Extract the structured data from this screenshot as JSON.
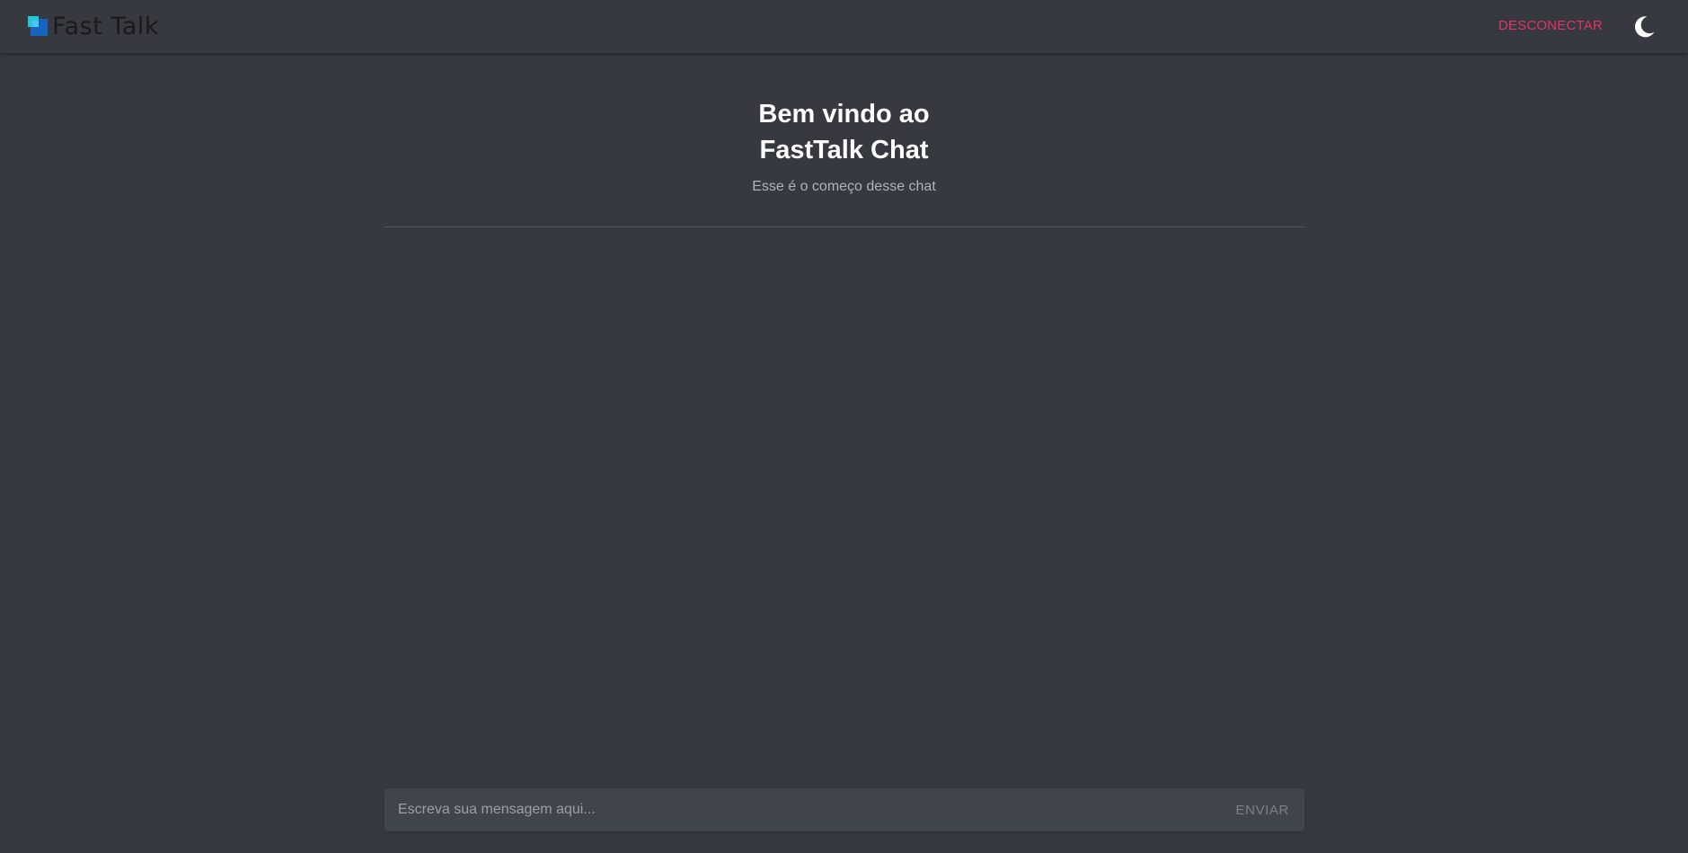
{
  "header": {
    "app_name": "Fast Talk",
    "logo_icon": "fasttalk-logo-icon",
    "disconnect_label": "DESCONECTAR",
    "theme_toggle_icon": "moon-icon"
  },
  "welcome": {
    "title_line1": "Bem vindo ao",
    "title_line2": "FastTalk Chat",
    "subtitle": "Esse é o começo desse chat"
  },
  "composer": {
    "placeholder": "Escreva sua mensagem aqui...",
    "value": "",
    "send_label": "ENVIAR"
  },
  "colors": {
    "background": "#363940",
    "accent_disconnect": "#e53363",
    "composer_background": "#40444b"
  }
}
